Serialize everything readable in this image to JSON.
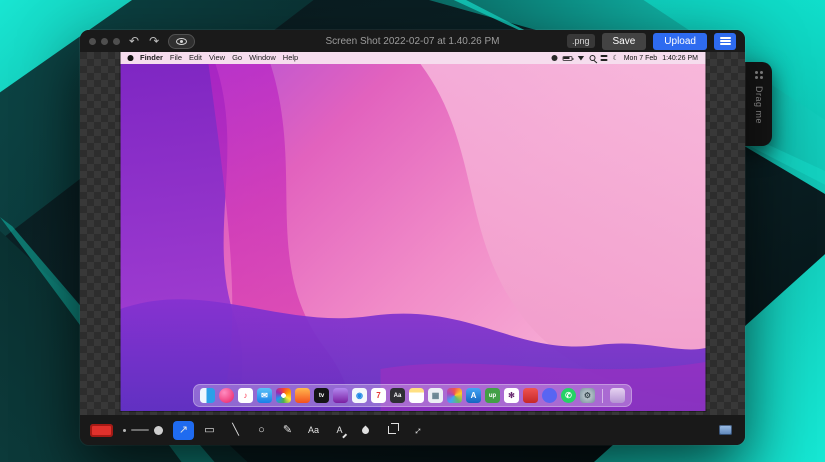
{
  "window": {
    "title": "Screen Shot 2022-02-07 at 1.40.26 PM",
    "format_badge": ".png",
    "save_label": "Save",
    "upload_label": "Upload",
    "undo_glyph": "↶",
    "redo_glyph": "↷"
  },
  "drag_tab": {
    "label": "Drag me"
  },
  "screenshot": {
    "menubar": {
      "items": [
        "Finder",
        "File",
        "Edit",
        "View",
        "Go",
        "Window",
        "Help"
      ],
      "date": "Mon 7 Feb",
      "time": "1:40:26 PM"
    },
    "dock": {
      "icons": [
        {
          "name": "finder",
          "bg": "linear-gradient(90deg,#eef7fe 0 45%,#2aa0e8 45%)"
        },
        {
          "name": "pink-circle-app",
          "bg": "radial-gradient(circle at 35% 30%,#ff8cc0,#e91e63)",
          "round": true
        },
        {
          "name": "music",
          "bg": "#ffffff",
          "glyph": "♪",
          "glyph_color": "#fa2d48"
        },
        {
          "name": "mail",
          "bg": "linear-gradient(#59c2f8,#1a7fe8)",
          "glyph": "✉",
          "glyph_color": "#ffffff"
        },
        {
          "name": "photos",
          "bg": "radial-gradient(circle,#ffffff 0 22%,rgba(0,0,0,0) 23%),conic-gradient(#f44336,#ff9800,#ffeb3b,#4caf50,#2196f3,#9c27b0,#f44336)"
        },
        {
          "name": "orange-app",
          "bg": "linear-gradient(#ffb74d,#f4511e)"
        },
        {
          "name": "apple-tv",
          "bg": "#141416",
          "glyph": "tv",
          "glyph_color": "#ffffff"
        },
        {
          "name": "podcasts",
          "bg": "linear-gradient(#b388f0,#7b1fa2)"
        },
        {
          "name": "safari",
          "bg": "#f4f8fb",
          "glyph": "◉",
          "glyph_color": "#1e88e5"
        },
        {
          "name": "calendar",
          "bg": "#ffffff",
          "glyph": "7",
          "glyph_color": "#e53935"
        },
        {
          "name": "dictionary",
          "bg": "#2f2f33",
          "glyph": "Aa",
          "glyph_color": "#ffffff"
        },
        {
          "name": "notes",
          "bg": "linear-gradient(#ffe082 0 30%,#ffffff 30%)"
        },
        {
          "name": "grid-app",
          "bg": "#eceff4",
          "glyph": "▦",
          "glyph_color": "#607d8b"
        },
        {
          "name": "colorful-app",
          "bg": "conic-gradient(#ef5350,#ffca28,#66bb6a,#42a5f5,#ab47bc,#ef5350)"
        },
        {
          "name": "app-store",
          "bg": "linear-gradient(#42a5f5,#1565c0)",
          "glyph": "A",
          "glyph_color": "#ffffff"
        },
        {
          "name": "upnote",
          "bg": "#43a047",
          "glyph": "up",
          "glyph_color": "#ffffff"
        },
        {
          "name": "slack",
          "bg": "#ffffff",
          "glyph": "✻",
          "glyph_color": "#611f69"
        },
        {
          "name": "red-app",
          "bg": "linear-gradient(#ef5350,#c62828)"
        },
        {
          "name": "indigo-circle-app",
          "bg": "#5865f2",
          "round": true
        },
        {
          "name": "whatsapp",
          "bg": "#25d366",
          "glyph": "✆",
          "glyph_color": "#ffffff",
          "round": true
        },
        {
          "name": "settings",
          "bg": "radial-gradient(#cfd8dc,#78909c)",
          "glyph": "⚙",
          "glyph_color": "#37474f"
        },
        {
          "name": "trash",
          "bg": "linear-gradient(rgba(255,255,255,.7),rgba(195,200,210,.45))",
          "sep": true
        }
      ]
    }
  },
  "toolbar": {
    "swatch_color": "#e0312c",
    "accent_color": "#1f6bf0",
    "tools": [
      {
        "name": "arrow",
        "glyph": "↗",
        "selected": true
      },
      {
        "name": "rectangle",
        "glyph": "▭"
      },
      {
        "name": "line",
        "glyph": "╲"
      },
      {
        "name": "ellipse",
        "glyph": "○"
      },
      {
        "name": "pencil",
        "glyph": "✎"
      },
      {
        "name": "text",
        "glyph": "Aa"
      },
      {
        "name": "text-style",
        "glyph": "A"
      },
      {
        "name": "blur",
        "glyph": ""
      },
      {
        "name": "crop",
        "glyph": ""
      },
      {
        "name": "resize",
        "glyph": "↔"
      }
    ]
  },
  "colors": {
    "button_blue": "#2e6bf0",
    "teal_accent": "#16e8d4"
  }
}
